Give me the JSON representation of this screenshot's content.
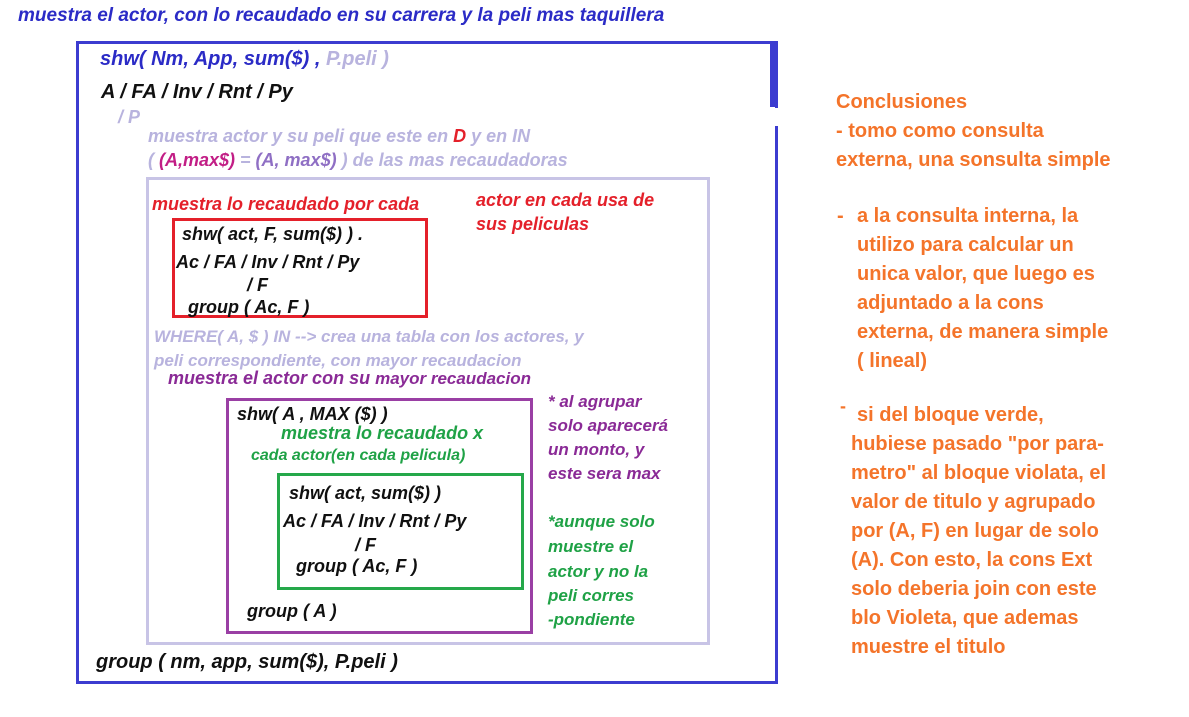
{
  "title": "muestra el actor, con lo recaudado en su carrera y la peli mas taquillera",
  "colors": {
    "outer_frame": "#3c3cd0",
    "lavender_frame": "#c8c4e6",
    "red_frame": "#e4202a",
    "violet_frame": "#9a3fa4",
    "green_frame": "#25a84a",
    "conclusions_text": "#f4742a"
  },
  "outer_query": {
    "shw_prefix": "shw( Nm, App,  sum($) , ",
    "shw_peli": "P.peli  )",
    "tables": "A / FA / Inv / Rnt / Py",
    "from_p": "/ P",
    "note_line1_a": "muestra actor y su peli que este en ",
    "note_line1_d": "D",
    "note_line1_b": " y en IN",
    "note_line2_a": "( ",
    "note_line2_b": "(A,max$)",
    "note_line2_c": " = ",
    "note_line2_d": "(A, max$)",
    "note_line2_e": " ) de las mas recaudadoras",
    "group": "group ( nm, app, sum($), P.peli )"
  },
  "red_block": {
    "label_left": "muestra lo recaudado por cada",
    "label_right_1": "actor en cada usa de",
    "label_right_2": "sus peliculas",
    "shw": "shw( act,  F,  sum($) ) .",
    "tables": "Ac / FA / Inv / Rnt / Py",
    "from_f": "/ F",
    "group": "group ( Ac, F )"
  },
  "where_note": {
    "line1": "WHERE( A, $ ) IN  --> crea una tabla con los actores, y",
    "line2": "peli correspondiente, con mayor recaudacion"
  },
  "violet_block": {
    "label_1": "muestra el actor con su ",
    "label_2": "mayor recaudacion",
    "shw": "shw( A , MAX ($) )",
    "group": "group ( A )",
    "note_1": "* al agrupar",
    "note_2": "solo aparecerá",
    "note_3": "un monto, y",
    "note_4": "este sera max"
  },
  "green_block": {
    "label_1": "muestra lo recaudado x",
    "label_2": "cada actor(en cada pelicula)",
    "shw": "shw( act, sum($) )",
    "tables": "Ac / FA / Inv / Rnt / Py",
    "from_f": "/ F",
    "group": "group ( Ac, F )",
    "note_1": "*aunque solo",
    "note_2": "muestre el",
    "note_3": "actor y no la",
    "note_4": "peli corres",
    "note_5": "-pondiente"
  },
  "conclusions": {
    "heading": "Conclusiones",
    "p1_1": " - tomo como consulta",
    "p1_2": "externa, una sonsulta simple",
    "p2_dash": "-",
    "p2_1": "a la consulta interna, la",
    "p2_2": "utilizo para calcular un",
    "p2_3": "unica valor, que luego es",
    "p2_4": "adjuntado a la cons",
    "p2_5": "externa, de manera simple",
    "p2_6": "( lineal)",
    "p3_dash": "-",
    "p3_1": "si del bloque verde,",
    "p3_2": "hubiese pasado \"por para-",
    "p3_3": "metro\" al bloque violata, el",
    "p3_4": "valor de titulo y agrupado",
    "p3_5": "por (A, F) en lugar de solo",
    "p3_6": "(A). Con esto, la cons Ext",
    "p3_7": "solo deberia join con este",
    "p3_8": "blo Violeta, que ademas",
    "p3_9": "muestre el titulo"
  }
}
